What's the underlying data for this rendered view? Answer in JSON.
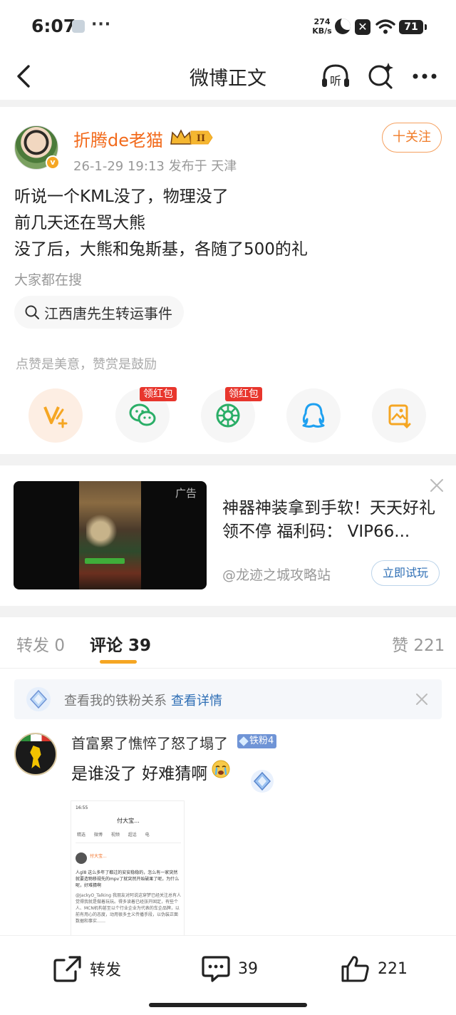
{
  "status_bar": {
    "time": "6:07",
    "more": "···",
    "speed_value": "274",
    "speed_unit": "KB/s",
    "battery": "71"
  },
  "nav": {
    "title": "微博正文",
    "listen_glyph": "听"
  },
  "post": {
    "author": "折腾de老猫",
    "vip_level": "II",
    "verified_glyph": "v",
    "meta": "26-1-29 19:13  发布于 天津",
    "follow_label": "十关注",
    "lines": [
      "听说一个KML没了，物理没了",
      "前几天还在骂大熊",
      "没了后，大熊和兔斯基，各随了500的礼"
    ],
    "search_label": "大家都在搜",
    "search_chip": "江西唐先生转运事件",
    "reward_hint": "点赞是美意，赞赏是鼓励",
    "red_packet_tag": "领红包",
    "share_icons": [
      "reward-icon",
      "wechat-icon",
      "moments-icon",
      "qq-icon",
      "save-image-icon"
    ]
  },
  "ad": {
    "tag": "广告",
    "title": "神器神装拿到手软！天天好礼领不停 福利码： VIP66...",
    "source": "@龙迹之城攻略站",
    "cta": "立即试玩"
  },
  "tabs": {
    "repost_label": "转发",
    "repost_count": "0",
    "comment_label": "评论",
    "comment_count": "39",
    "like_label": "赞",
    "like_count": "221"
  },
  "fan_bar": {
    "text": "查看我的铁粉关系",
    "link": "查看详情"
  },
  "comment": {
    "name": "首富累了憔悴了怒了塌了",
    "badge": "铁粉4",
    "text": "是谁没了 好难猜啊",
    "image": {
      "status": "16:55",
      "title": "付大宝...",
      "tabs": "精选 微博 视频 超话 电",
      "name": "付大宝...",
      "text": "人gl8 这么多年了都过的安安稳稳的，怎么有一家突然就要造物移规先的mpv了就突然开始破果了呢，为什么呢，好难猜啊",
      "quote": "@JackyO_Talking 我朋友对阿说这穿梦已经关注总有人觉得我就是做着玩玩。得多读着已经张开固定，有些个人、MCN机构甚至以个行业企业为代表的车企品牌，以前有用心的态度，动用很多主义传播手段，以伪装正面数据和事实……"
    }
  },
  "bottom_bar": {
    "repost_label": "转发",
    "comment_count": "39",
    "like_count": "221"
  },
  "colors": {
    "accent_orange": "#f26b1d",
    "link_blue": "#2f6fb5",
    "red_tag": "#e8362d",
    "tab_underline": "#f5a623"
  }
}
